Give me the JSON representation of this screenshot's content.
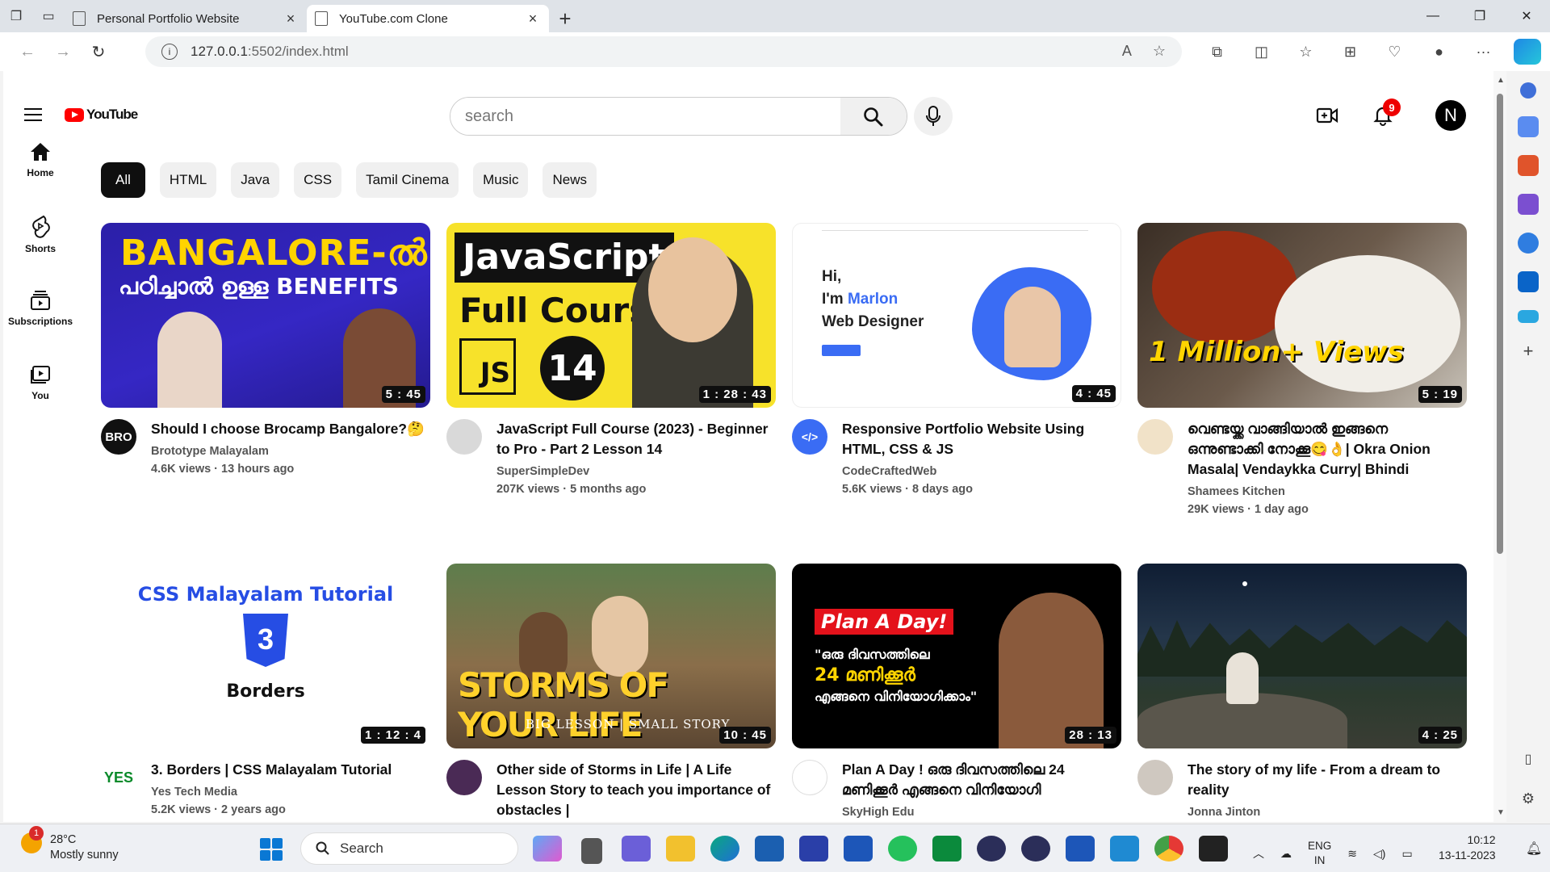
{
  "browser": {
    "tabs": [
      {
        "label": "Personal Portfolio Website",
        "active": false
      },
      {
        "label": "YouTube.com Clone",
        "active": true
      }
    ],
    "url_host": "127.0.0.1",
    "url_rest": ":5502/index.html"
  },
  "header": {
    "logo_text": "YouTube",
    "search_placeholder": "search",
    "notification_count": "9",
    "avatar_letter": "N"
  },
  "leftnav": [
    {
      "label": "Home",
      "icon": "home-icon"
    },
    {
      "label": "Shorts",
      "icon": "shorts-icon"
    },
    {
      "label": "Subscriptions",
      "icon": "subscriptions-icon"
    },
    {
      "label": "You",
      "icon": "library-icon"
    }
  ],
  "chips": [
    "All",
    "HTML",
    "Java",
    "CSS",
    "Tamil Cinema",
    "Music",
    "News"
  ],
  "videos": [
    {
      "title": "Should I choose Brocamp Bangalore?🤔",
      "channel": "Brototype Malayalam",
      "stats": "4.6K views · 13 hours ago",
      "duration": "5 : 45",
      "thumb_line1": "BANGALORE-ൽ",
      "thumb_line2": "പഠിച്ചാൽ ഉള്ള BENEFITS",
      "avatar_text": "BRO"
    },
    {
      "title": "JavaScript Full Course (2023) - Beginner to Pro - Part 2 Lesson 14",
      "channel": "SuperSimpleDev",
      "stats": "207K views · 5 months ago",
      "duration": "1 : 28 : 43",
      "thumb_line1": "JavaScript",
      "thumb_line2": "Full Course",
      "thumb_js": "JS",
      "thumb_num": "14",
      "avatar_text": ""
    },
    {
      "title": "Responsive Portfolio Website Using HTML, CSS & JS",
      "channel": "CodeCraftedWeb",
      "stats": "5.6K views · 8 days ago",
      "duration": "4 : 45",
      "thumb_hi": "Hi,",
      "thumb_im": "I'm ",
      "thumb_name": "Marlon",
      "thumb_role": "Web Designer",
      "avatar_text": "</>"
    },
    {
      "title": "വെണ്ടയ്ക്ക വാങ്ങിയാൽ ഇങ്ങനെ ഒന്നുണ്ടാക്കി നോക്കൂ😋👌| Okra Onion Masala| Vendaykka Curry| Bhindi",
      "channel": "Shamees Kitchen",
      "stats": "29K views · 1 day ago",
      "duration": "5 : 19",
      "thumb_badge": "1 Million+ Views",
      "avatar_text": ""
    },
    {
      "title": "3. Borders | CSS Malayalam Tutorial",
      "channel": "Yes Tech Media",
      "stats": "5.2K views · 2 years ago",
      "duration": "1 : 12 : 4",
      "thumb_line1": "CSS Malayalam Tutorial",
      "thumb_line2": "Borders",
      "avatar_text": "YES"
    },
    {
      "title": "Other side of Storms in Life | A Life Lesson Story to teach you importance of obstacles |",
      "channel": "",
      "stats": "",
      "duration": "10 : 45",
      "thumb_line1": "STORMS OF YOUR LIFE",
      "thumb_line2": "BIG LESSON | SMALL STORY",
      "avatar_text": ""
    },
    {
      "title": "Plan A Day ! ഒരു ദിവസത്തിലെ 24 മണിക്കൂർ എങ്ങനെ വിനിയോഗി",
      "channel": "SkyHigh Edu",
      "stats": "",
      "duration": "28 : 13",
      "thumb_line1": "Plan A Day!",
      "thumb_line2": "\"ഒരു ദിവസത്തിലെ",
      "thumb_line3": "24 മണിക്കൂർ",
      "thumb_line4": "എങ്ങനെ വിനിയോഗിക്കാം\"",
      "avatar_text": ""
    },
    {
      "title": "The story of my life - From a dream to reality",
      "channel": "Jonna Jinton",
      "stats": "",
      "duration": "4 : 25",
      "avatar_text": ""
    }
  ],
  "taskbar": {
    "weather_temp": "28°C",
    "weather_desc": "Mostly sunny",
    "weather_badge": "1",
    "search_label": "Search",
    "lang_1": "ENG",
    "lang_2": "IN",
    "time": "10:12",
    "date": "13-11-2023"
  }
}
